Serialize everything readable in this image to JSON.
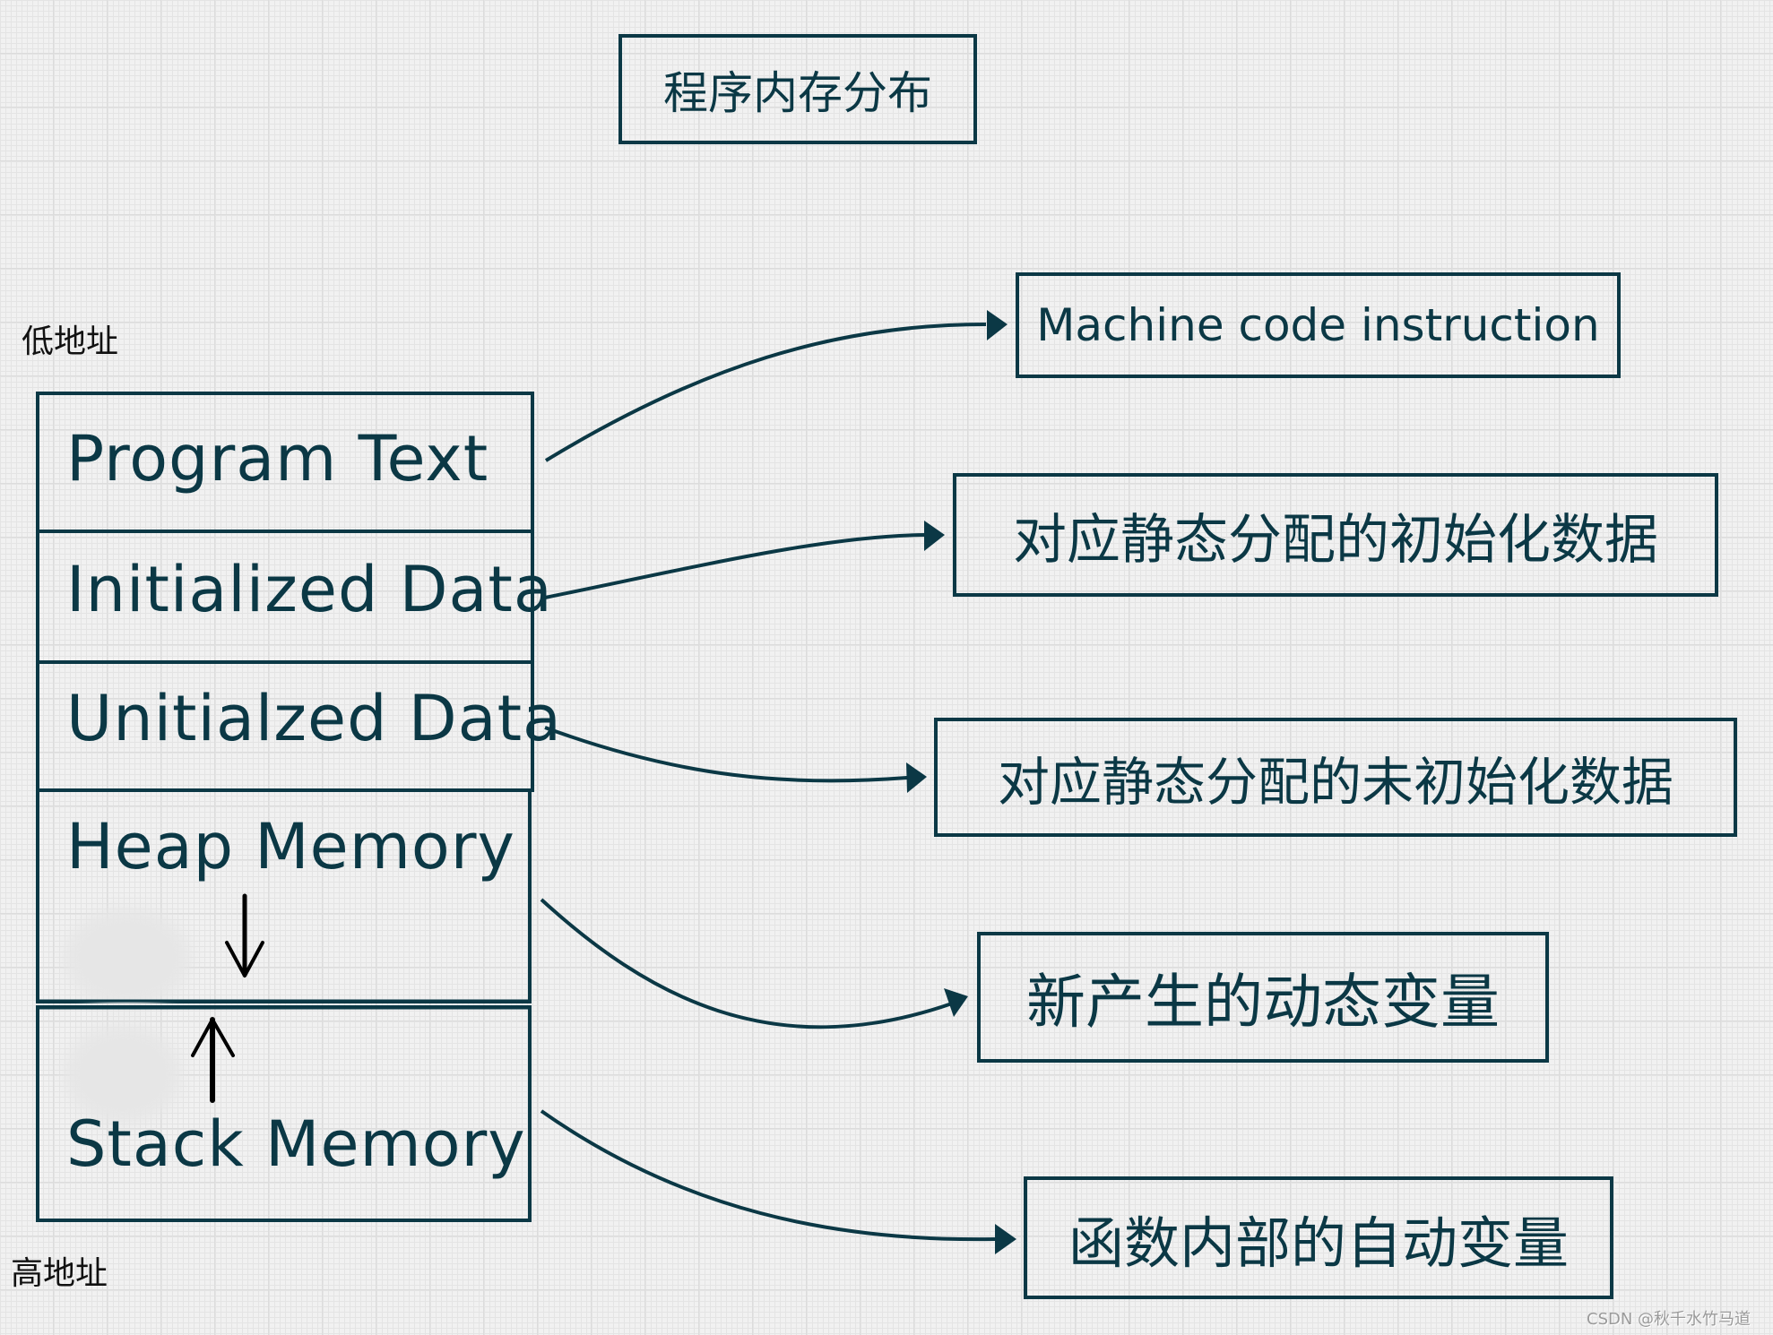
{
  "title": "程序内存分布",
  "address_labels": {
    "low": "低地址",
    "high": "高地址"
  },
  "memory_segments": [
    {
      "label": "Program Text"
    },
    {
      "label": "Initialized Data"
    },
    {
      "label": "Unitialzed Data"
    },
    {
      "label": "Heap Memory",
      "growth": "down"
    },
    {
      "label": "Stack Memory",
      "growth": "up"
    }
  ],
  "descriptions": [
    {
      "text": "Machine code instruction",
      "target": "Program Text"
    },
    {
      "text": "对应静态分配的初始化数据",
      "target": "Initialized Data"
    },
    {
      "text": "对应静态分配的未初始化数据",
      "target": "Unitialzed Data"
    },
    {
      "text": "新产生的动态变量",
      "target": "Heap Memory"
    },
    {
      "text": "函数内部的自动变量",
      "target": "Stack Memory"
    }
  ],
  "colors": {
    "ink": "#0b3845",
    "background": "#f1f1f1"
  },
  "watermark": "CSDN @秋千水竹马道"
}
